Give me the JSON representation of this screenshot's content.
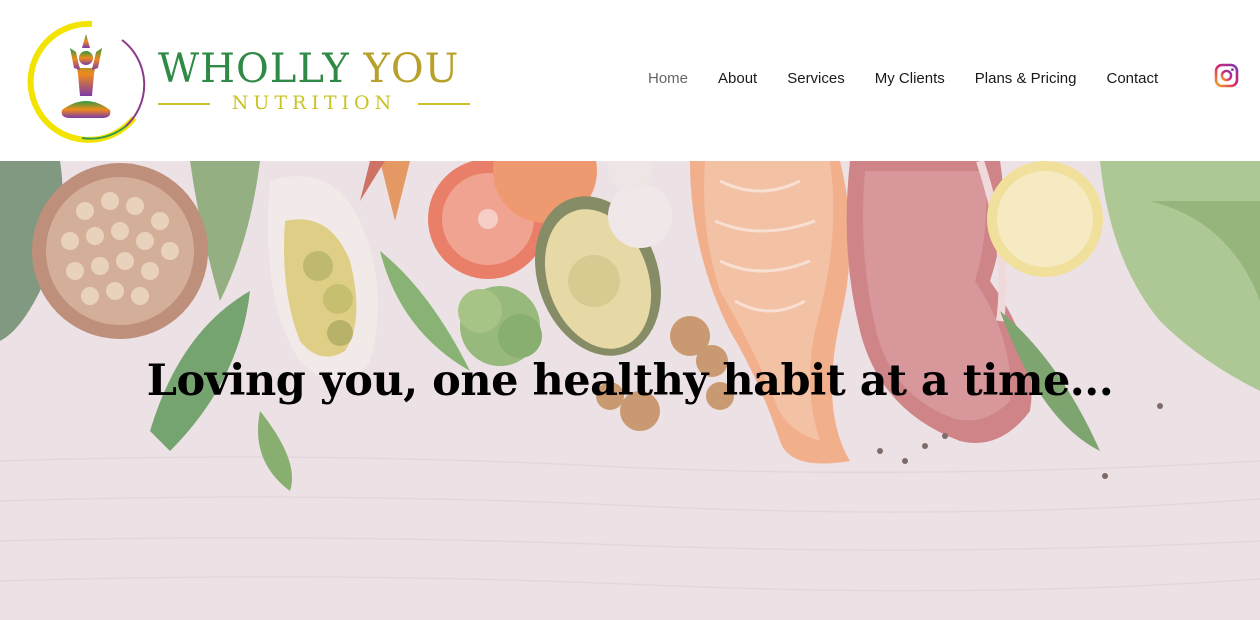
{
  "brand": {
    "name_part1": "WHOLLY ",
    "name_part2": "YOU",
    "tagline": "NUTRITION"
  },
  "nav": {
    "items": [
      {
        "label": "Home",
        "active": true
      },
      {
        "label": "About"
      },
      {
        "label": "Services"
      },
      {
        "label": "My Clients"
      },
      {
        "label": "Plans & Pricing"
      },
      {
        "label": "Contact"
      }
    ],
    "instagram_icon": "instagram-icon"
  },
  "hero": {
    "headline": "Loving you, one healthy habit at a time..."
  },
  "colors": {
    "brand_green": "#2f8a45",
    "brand_gold": "#b8a12a",
    "tagline_yellow": "#c9c324",
    "nav_text": "#1a1a1a",
    "nav_active": "#666666"
  }
}
